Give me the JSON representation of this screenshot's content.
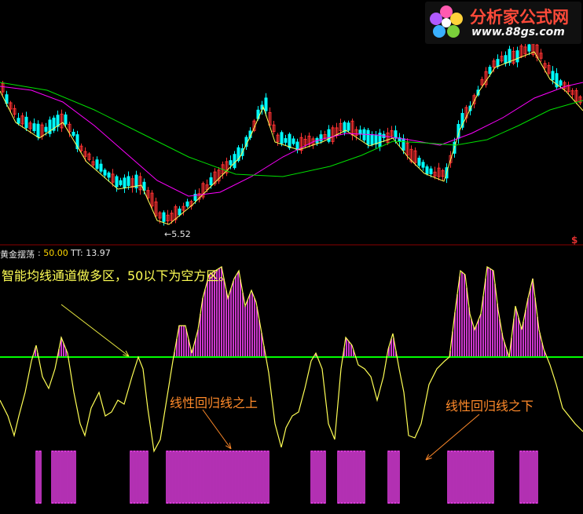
{
  "logo": {
    "title": "分析家公式网",
    "url": "www.88gs.com"
  },
  "price_panel": {
    "low_label": "←5.52",
    "corner_mark": "$"
  },
  "indicator_panel": {
    "name": "黄金摆荡",
    "value_prefix": ":",
    "value": "50.00",
    "tt_label": "TT:",
    "tt_value": "13.97",
    "caption": "智能均线通道做多区，50以下为空方区。",
    "annotation_above": "线性回归线之上",
    "annotation_below": "线性回归线之下"
  },
  "colors": {
    "background": "#000000",
    "candle_up": "#ff3232",
    "candle_down": "#00ffff",
    "ma_short": "#ffff55",
    "ma_mid": "#ff00ff",
    "ma_long": "#00e000",
    "oscillator": "#ffff55",
    "level_line": "#00ff00",
    "histogram": "#ff44ff",
    "annotation": "#ff8a2a",
    "arrow_caption": "#e8e840"
  },
  "chart_data": [
    {
      "type": "candlestick",
      "panel": "price",
      "series": [
        {
          "name": "candles",
          "length": 148
        },
        {
          "name": "ma_short"
        },
        {
          "name": "ma_mid"
        },
        {
          "name": "ma_long"
        }
      ],
      "annotations": [
        {
          "text": "←5.52",
          "meaning": "period low"
        }
      ]
    },
    {
      "type": "line",
      "panel": "indicator",
      "name": "黄金摆荡",
      "current_value": 50.0,
      "tt": 13.97,
      "level": 50,
      "series": [
        {
          "name": "TT"
        }
      ],
      "histogram_above_level": true,
      "regression_bars": true
    }
  ]
}
